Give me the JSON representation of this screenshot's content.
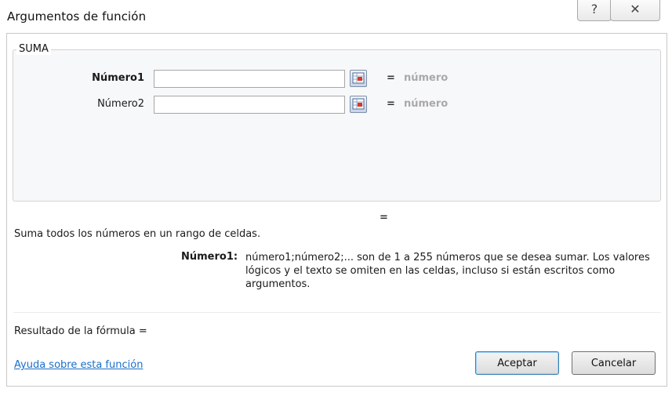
{
  "window": {
    "title": "Argumentos de función",
    "help_icon": "question-mark-icon",
    "close_icon": "close-icon"
  },
  "function": {
    "name": "SUMA",
    "args": [
      {
        "label": "Número1",
        "value": "",
        "equals": "=",
        "result": "número",
        "bold": true
      },
      {
        "label": "Número2",
        "value": "",
        "equals": "=",
        "result": "número",
        "bold": false
      }
    ],
    "collapse_icon": "range-select-icon",
    "result_equals": "=",
    "description": "Suma todos los números en un rango de celdas.",
    "arg_help_name": "Número1:",
    "arg_help_text": "número1;número2;... son de 1 a 255 números que se desea sumar. Los valores lógicos y el texto se omiten en las celdas, incluso si están escritos como argumentos."
  },
  "footer": {
    "formula_result": "Resultado de la fórmula =",
    "help_link": "Ayuda sobre esta función",
    "ok_label": "Aceptar",
    "cancel_label": "Cancelar"
  },
  "colors": {
    "link": "#1a6fc9",
    "placeholder_result": "#a9a9a9",
    "group_bg": "#f7f8fa"
  }
}
